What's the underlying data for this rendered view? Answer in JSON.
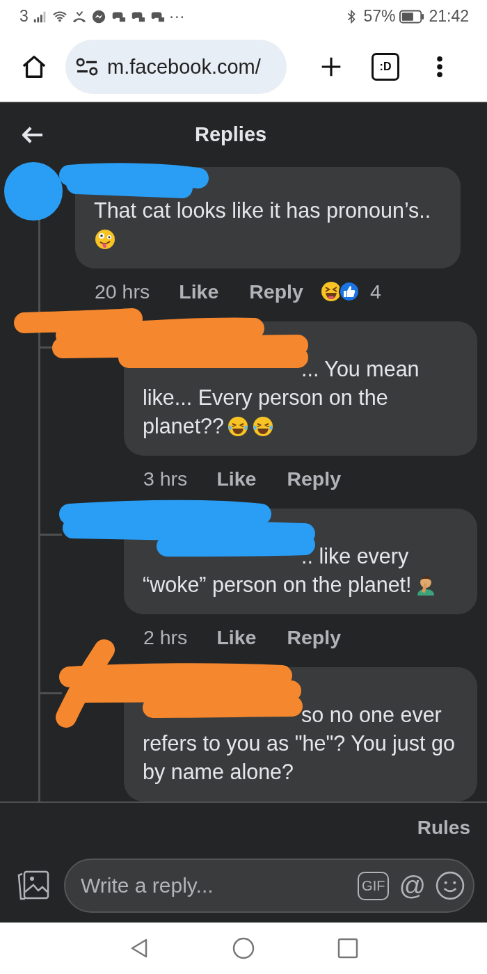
{
  "status_bar": {
    "carrier": "3",
    "more": "···",
    "battery": "57%",
    "time": "21:42"
  },
  "browser": {
    "url": "m.facebook.com/",
    "tab_label": ":D"
  },
  "header": {
    "title": "Replies"
  },
  "comments": [
    {
      "kind": "top",
      "text": "That cat looks like it has pronoun’s..",
      "emojis": [
        {
          "kind": "zany"
        }
      ],
      "redaction": {
        "color": "#2a9df4"
      },
      "time": "20 hrs",
      "like": "Like",
      "reply": "Reply",
      "reactions": [
        {
          "kind": "haha"
        },
        {
          "kind": "like"
        }
      ],
      "reaction_count": "4"
    },
    {
      "kind": "inline",
      "text": "... You mean like... Every person on the planet??",
      "emojis": [
        {
          "kind": "tears"
        },
        {
          "kind": "tears"
        }
      ],
      "redaction": {
        "color": "#f5882e"
      },
      "time": "3 hrs",
      "like": "Like",
      "reply": "Reply"
    },
    {
      "kind": "inline",
      "text": ".. like every “woke” person on the planet!",
      "emojis": [
        {
          "kind": "facepalm"
        }
      ],
      "redaction": {
        "color": "#2a9df4"
      },
      "time": "2 hrs",
      "like": "Like",
      "reply": "Reply"
    },
    {
      "kind": "inline",
      "text": "so no one ever refers to you as \"he\"? You just go by name alone?",
      "redaction": {
        "color": "#f5882e"
      }
    }
  ],
  "footer": {
    "rules": "Rules"
  },
  "composer": {
    "placeholder": "Write a reply...",
    "gif_label": "GIF",
    "mention_label": "@"
  }
}
